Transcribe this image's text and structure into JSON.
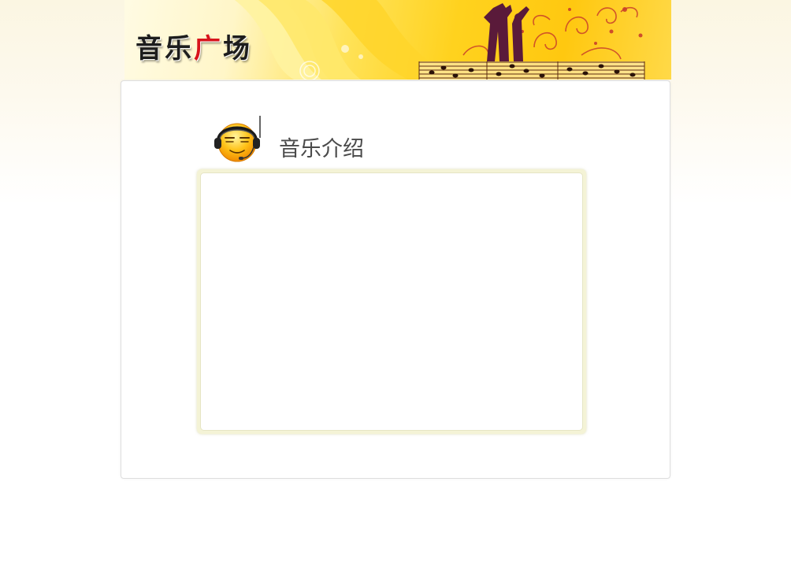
{
  "banner": {
    "logo": {
      "char1": "音",
      "char2": "乐",
      "char3": "广",
      "char4": "场"
    }
  },
  "section": {
    "title": "音乐介绍",
    "icon": "headphone-smiley-icon"
  },
  "content": {
    "text": ""
  },
  "colors": {
    "banner_yellow": "#ffd21e",
    "logo_red": "#d8141c",
    "title_text": "#4a4a4a",
    "frame_bg": "#f4f3d6"
  }
}
